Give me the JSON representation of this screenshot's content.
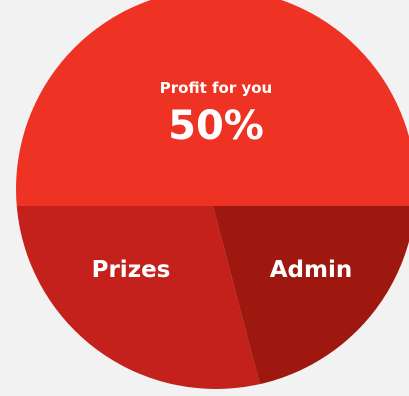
{
  "chart_data": {
    "type": "pie",
    "slices": [
      {
        "label": "Profit for you",
        "value": 50,
        "value_label": "50%",
        "color": "#ee3224"
      },
      {
        "label": "Prizes",
        "value": 30,
        "color": "#c4211c"
      },
      {
        "label": "Admin",
        "value": 20,
        "color": "#9e180f"
      }
    ]
  }
}
